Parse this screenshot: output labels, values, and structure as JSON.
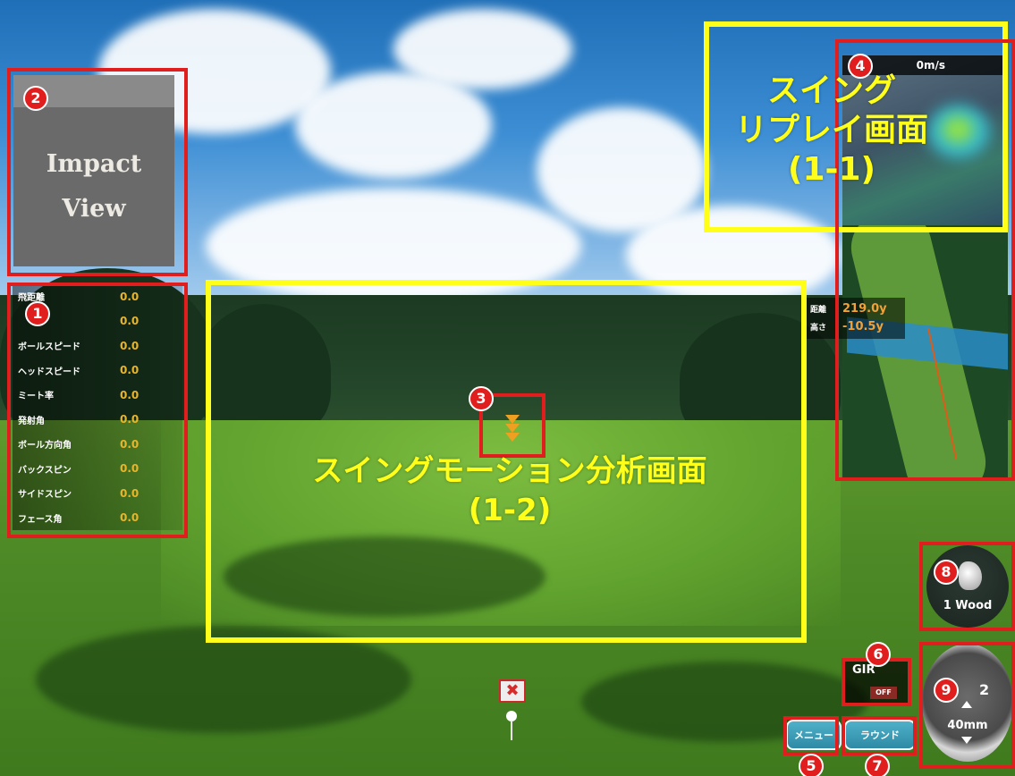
{
  "impact_view": {
    "label": "Impact View"
  },
  "stats": [
    {
      "label": "飛距離",
      "value": "0.0"
    },
    {
      "label": "",
      "value": "0.0"
    },
    {
      "label": "ボールスピード",
      "value": "0.0"
    },
    {
      "label": "ヘッドスピード",
      "value": "0.0"
    },
    {
      "label": "ミート率",
      "value": "0.0"
    },
    {
      "label": "発射角",
      "value": "0.0"
    },
    {
      "label": "ボール方向角",
      "value": "0.0"
    },
    {
      "label": "バックスピン",
      "value": "0.0"
    },
    {
      "label": "サイドスピン",
      "value": "0.0"
    },
    {
      "label": "フェース角",
      "value": "0.0"
    }
  ],
  "replay": {
    "wind_speed": "0m/s",
    "caption_line1": "スイング",
    "caption_line2": "リプレイ画面",
    "caption_line3": "(1-1)"
  },
  "minimap": {
    "distance_label": "距離",
    "distance_value": "219.0y",
    "height_label": "高さ",
    "height_value": "-10.5y"
  },
  "motion_area": {
    "caption_line1": "スイングモーション分析画面",
    "caption_line2": "(1-2)"
  },
  "tee_marker": {
    "symbol": "✖"
  },
  "gir": {
    "label": "GIR",
    "badge": "OFF"
  },
  "buttons": {
    "menu": "メニュー",
    "round": "ラウンド"
  },
  "club": {
    "name": "1 Wood"
  },
  "tee_height": {
    "top": "2",
    "value": "40mm"
  },
  "badges": [
    "1",
    "2",
    "3",
    "4",
    "5",
    "6",
    "7",
    "8",
    "9"
  ],
  "colors": {
    "annotation_red": "#e01e1e",
    "annotation_yellow": "#ffff1a",
    "stat_value": "#e8b52b",
    "button_teal": "#3a9db8"
  }
}
